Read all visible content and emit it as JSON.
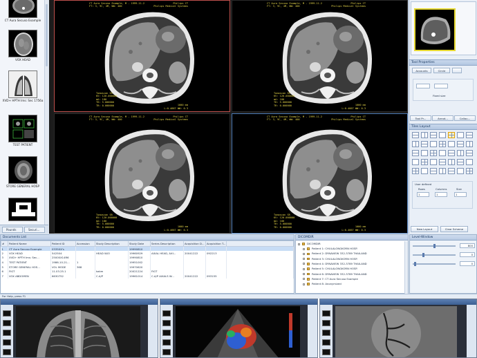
{
  "studies": [
    {
      "label": "CT Aura Secuso Example"
    },
    {
      "label": "VOX HEAD"
    },
    {
      "label": "XVD+ HPTH Ims: Sec 1756a"
    },
    {
      "label": "TEST PATIENT"
    },
    {
      "label": "STORE GENERAL HOSP"
    },
    {
      "label": ""
    }
  ],
  "left_tabs": {
    "tab1": "Pounds",
    "tab2": "Securi..."
  },
  "viewports": [
    {
      "overlay_tl": [
        "CT Aura Secuso Example, M - 1999-11-2",
        "FT: 3, 9C, 4M, WW: 400"
      ],
      "overlay_tr": [
        "Philips CT",
        "Philips Medical Systems"
      ],
      "overlay_bl": [
        "Tomoscan SR",
        "KV: 120.000000",
        "mA: 180",
        "TH: 5.000000",
        "TR: 0.000000"
      ],
      "overlay_br": [
        "1000 mm",
        "L:0.4667 WW: 0.3"
      ]
    },
    {
      "overlay_tl": [
        "CT Aura Secuso Example, M - 1999-11-2",
        "FT: 3, 9C, 4M, WW: 400"
      ],
      "overlay_tr": [
        "Philips CT",
        "Philips Medical Systems"
      ],
      "overlay_bl": [
        "Tomoscan SR",
        "KV: 120.000000",
        "mA: 180",
        "TH: 5.000000",
        "TR: 0.000000"
      ],
      "overlay_br": [
        "1000 mm",
        "L:0.4667 WW: 0.3"
      ]
    },
    {
      "overlay_tl": [
        "CT Aura Secuso Example, M - 1999-11-2",
        "FT: 3, 9C, 4M, WW: 400"
      ],
      "overlay_tr": [
        "Philips CT",
        "Philips Medical Systems"
      ],
      "overlay_bl": [
        "Tomoscan SR",
        "KV: 120.000000",
        "mA: 180",
        "TH: 5.000000",
        "TR: 0.000000"
      ],
      "overlay_br": [
        "1000 mm",
        "L:0.4667 WW: 0.3"
      ]
    },
    {
      "overlay_tl": [
        "CT Aura Secuso Example, M - 1999-11-2",
        "FT: 3, 9C, 4M, WW: 400"
      ],
      "overlay_tr": [
        "Philips CT",
        "Philips Medical Systems"
      ],
      "overlay_bl": [
        "Tomoscan SR",
        "KV: 120.000000",
        "mA: 180",
        "TH: 5.000000",
        "TR: 0.000000"
      ],
      "overlay_br": [
        "1000 mm",
        "L:0.4667 WW: 0.3"
      ]
    }
  ],
  "right_panel": {
    "tool_properties": "Tool Properties",
    "tool_btn_1": "Accounts",
    "tool_btn_2": "Circle",
    "fixed_size": "Fixed size",
    "tab1": "Tool Pr...",
    "tab2": "Annot...",
    "tab3": "Callou...",
    "tiles_layout": "Tiles Layout",
    "user_defined": "User defined",
    "rows_label": "Rows",
    "columns_label": "Columns",
    "size_label": "Size",
    "rows_value": "1",
    "columns_value": "1",
    "size_value": "1",
    "new_layout": "New Layout",
    "clear_scheme": "Clear Scheme"
  },
  "documents": {
    "title": "Documents List",
    "columns": [
      "#",
      "Patient Name",
      "Patient ID",
      "Accession",
      "Study Description",
      "Study Date",
      "Series Description",
      "Acquisition D...",
      "Acquisition T..."
    ],
    "rows": [
      [
        "1",
        "CT Aura Secuso Example",
        "0335XX's",
        "",
        "",
        "19990810",
        "",
        "",
        ""
      ],
      [
        "2",
        "VOX HEAD",
        "542504",
        "",
        "HEAD W/O",
        "19960929",
        "AXIAL HEAD, AXI...",
        "20041222",
        "092213"
      ],
      [
        "3",
        "XVD+ HPTH Ims: Sec...",
        "25000X14R6",
        "",
        "",
        "19990810",
        "",
        "",
        ""
      ],
      [
        "4",
        "TEST PATIENT",
        "1986-10-21...",
        "1",
        "",
        "19951002",
        "",
        "",
        ""
      ],
      [
        "5",
        "STORE GENERAL HOS...",
        "VOL MODE",
        "368",
        "",
        "19970620",
        "",
        "",
        ""
      ],
      [
        "6",
        "FIGT",
        "11.03.25.1",
        "",
        "kakm",
        "20021224",
        "FIGT",
        "",
        ""
      ],
      [
        "7",
        "VOX ABDOMEN",
        "6630752",
        "",
        "C.A/P",
        "19961014",
        "C.A/P AXIALS W...",
        "20041222",
        "093155"
      ]
    ]
  },
  "dicomdir": {
    "title": "DICOMDIR",
    "root": "DICOMDIR",
    "items": [
      "Patient 1: CHULALONGKORN HOSP.",
      "Patient 2: DYNAVIEW 332-3789 THAILAND",
      "Patient 3: CHULALONGKORN HOSP.",
      "Patient 4: DYNAVIEW 332-3789 THAILAND",
      "Patient 5: CHULALONGKORN HOSP.",
      "Patient 6: DYNAVIEW 332-3789 THAILAND",
      "Patient 7: CT Aura Secuso Example",
      "Patient 8: Anonymized"
    ]
  },
  "window_level": {
    "title": "Level-Window",
    "value1": "800",
    "value2": "0",
    "value3": "0"
  },
  "status": {
    "text": "For Help, press F1"
  }
}
